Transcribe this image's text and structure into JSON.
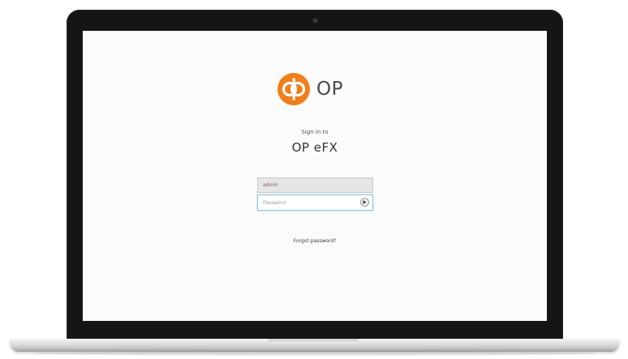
{
  "brand": {
    "name": "OP",
    "logo_color": "#ef7f1a",
    "logo_icon": "op-logo-icon"
  },
  "login": {
    "sign_in_label": "Sign in to",
    "app_title": "OP eFX",
    "username_value": "admin",
    "password_placeholder": "Password",
    "submit_icon": "arrow-right-icon",
    "forgot_password": "Forgot password?"
  },
  "colors": {
    "accent": "#ef7f1a",
    "focus_border": "#8fc3dc"
  }
}
